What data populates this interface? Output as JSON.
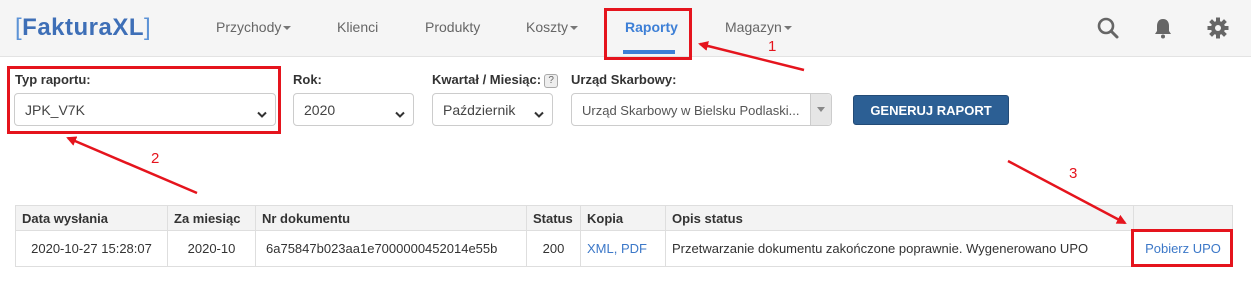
{
  "app": {
    "logo_left": "[",
    "logo_name": "FakturaXL",
    "logo_right": "]"
  },
  "nav": {
    "items": [
      {
        "label": "Przychody",
        "dropdown": true
      },
      {
        "label": "Klienci",
        "dropdown": false
      },
      {
        "label": "Produkty",
        "dropdown": false
      },
      {
        "label": "Koszty",
        "dropdown": true
      },
      {
        "label": "Raporty",
        "dropdown": false,
        "active": true
      },
      {
        "label": "Magazyn",
        "dropdown": true
      }
    ],
    "icons": [
      "search-icon",
      "bell-icon",
      "gear-icon"
    ]
  },
  "form": {
    "typ_label": "Typ raportu:",
    "typ_value": "JPK_V7K",
    "rok_label": "Rok:",
    "rok_value": "2020",
    "okres_label": "Kwartał / Miesiąc:",
    "okres_help": "?",
    "okres_value": "Październik",
    "urzad_label": "Urząd Skarbowy:",
    "urzad_value": "Urząd Skarbowy w Bielsku Podlaski...",
    "generate_label": "GENERUJ RAPORT"
  },
  "table": {
    "headers": [
      "Data wysłania",
      "Za miesiąc",
      "Nr dokumentu",
      "Status",
      "Kopia",
      "Opis status",
      ""
    ],
    "row": {
      "date": "2020-10-27 15:28:07",
      "month": "2020-10",
      "doc": "6a75847b023aa1e7000000452014e55b",
      "status": "200",
      "kopia": "XML, PDF",
      "opis": "Przetwarzanie dokumentu zakończone poprawnie. Wygenerowano UPO",
      "action": "Pobierz UPO"
    }
  },
  "annotations": {
    "n1": "1",
    "n2": "2",
    "n3": "3",
    "color": "#e5141d"
  },
  "colors": {
    "accent": "#3d7fd6",
    "button": "#2c5f94",
    "annotation": "#e5141d"
  }
}
